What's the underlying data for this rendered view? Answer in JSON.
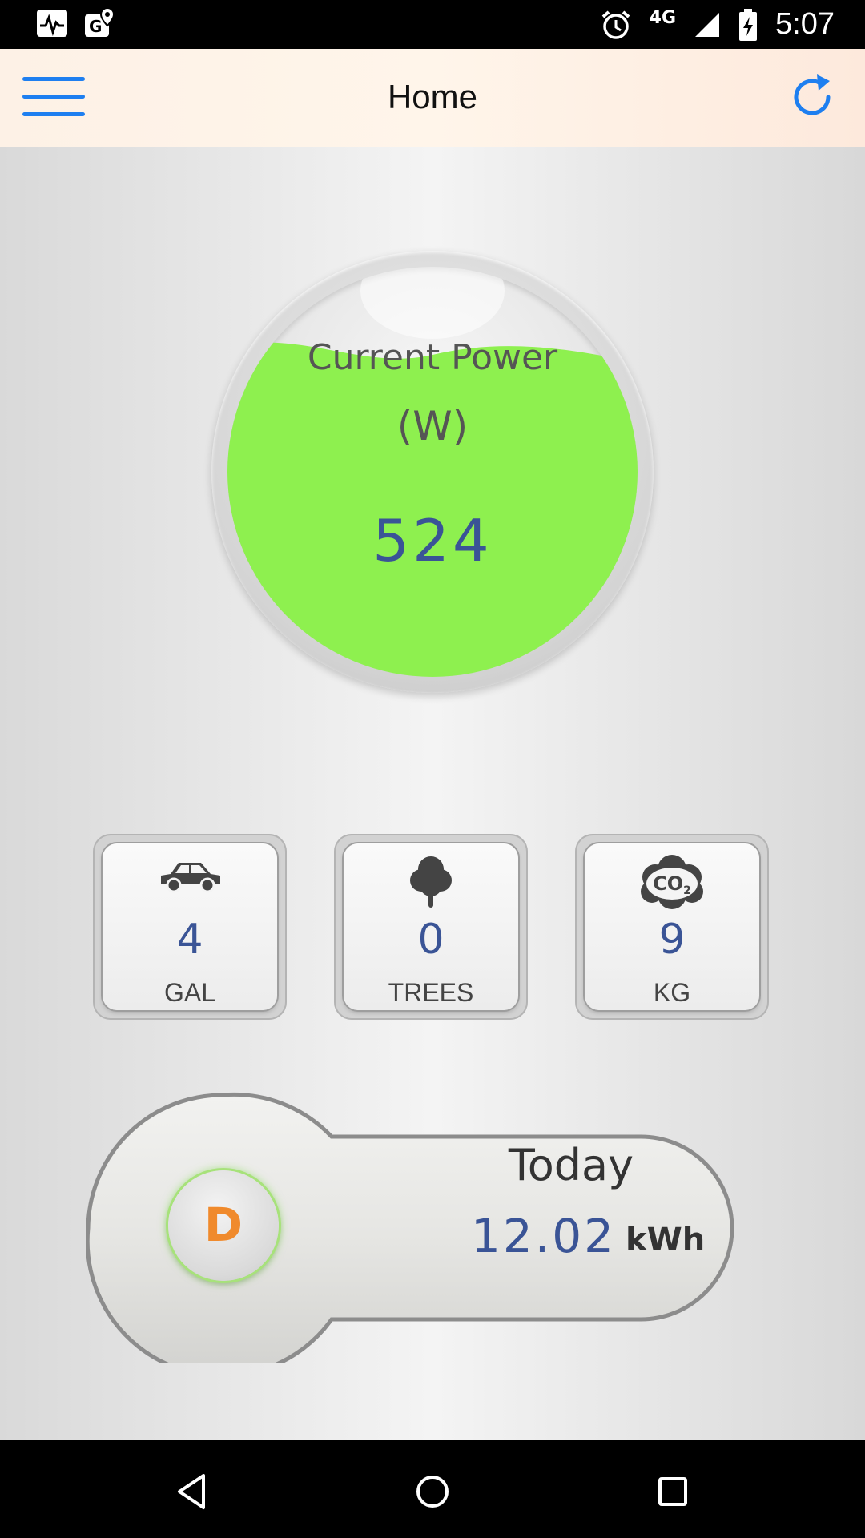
{
  "status_bar": {
    "network": "4G",
    "time": "5:07"
  },
  "app_bar": {
    "title": "Home"
  },
  "gauge": {
    "title": "Current Power",
    "unit": "(W)",
    "value": "524",
    "fill_color": "#8ef04f"
  },
  "tiles": [
    {
      "icon": "car-icon",
      "value": "4",
      "label": "GAL"
    },
    {
      "icon": "tree-icon",
      "value": "0",
      "label": "TREES"
    },
    {
      "icon": "co2-cloud-icon",
      "value": "9",
      "label": "KG"
    }
  ],
  "today": {
    "button_label": "D",
    "label": "Today",
    "value": "12.02",
    "unit": "kWh"
  },
  "colors": {
    "accent": "#1e7ff0",
    "value_text": "#3a5496",
    "period_button": "#f08a2c"
  }
}
